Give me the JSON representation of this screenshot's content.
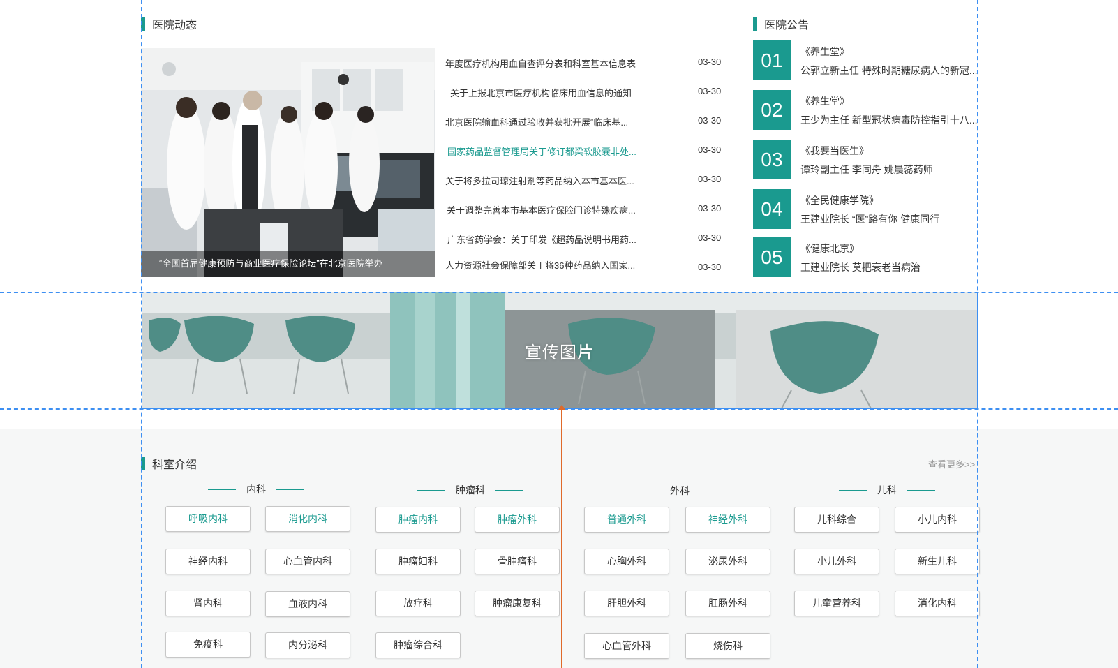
{
  "news": {
    "title": "医院动态",
    "photo_caption": "“全国首届健康预防与商业医疗保险论坛”在北京医院举办",
    "items": [
      {
        "title": "年度医疗机构用血自查评分表和科室基本信息表",
        "date": "03-30"
      },
      {
        "title": "关于上报北京市医疗机构临床用血信息的通知",
        "date": "03-30"
      },
      {
        "title": "北京医院输血科通过验收并获批开展“临床基...",
        "date": "03-30"
      },
      {
        "title": "国家药品监督管理局关于修订都梁软胶囊非处...",
        "date": "03-30"
      },
      {
        "title": "关于将多拉司琼注射剂等药品纳入本市基本医...",
        "date": "03-30"
      },
      {
        "title": "关于调整完善本市基本医疗保险门诊特殊疾病...",
        "date": "03-30"
      },
      {
        "title": "广东省药学会：关于印发《超药品说明书用药...",
        "date": "03-30"
      },
      {
        "title": "人力资源社会保障部关于将36种药品纳入国家...",
        "date": "03-30"
      }
    ]
  },
  "notices": {
    "title": "医院公告",
    "items": [
      {
        "num": "01",
        "source": "《养生堂》",
        "text": "公郭立新主任 特殊时期糖尿病人的新冠..."
      },
      {
        "num": "02",
        "source": "《养生堂》",
        "text": "王少为主任 新型冠状病毒防控指引十八..."
      },
      {
        "num": "03",
        "source": "《我要当医生》",
        "text": "谭玲副主任 李同舟 姚晨蕊药师"
      },
      {
        "num": "04",
        "source": "《全民健康学院》",
        "text": "王建业院长 “医”路有你 健康同行"
      },
      {
        "num": "05",
        "source": "《健康北京》",
        "text": "王建业院长 莫把衰老当病治"
      }
    ]
  },
  "banner": {
    "label": "宣传图片"
  },
  "departments": {
    "title": "科室介绍",
    "more": "查看更多>>",
    "categories": [
      {
        "name": "内科",
        "items": [
          "呼吸内科",
          "消化内科",
          "神经内科",
          "心血管内科",
          "肾内科",
          "血液内科",
          "免疫科",
          "内分泌科"
        ]
      },
      {
        "name": "肿瘤科",
        "items": [
          "肿瘤内科",
          "肿瘤外科",
          "肿瘤妇科",
          "骨肿瘤科",
          "放疗科",
          "肿瘤康复科",
          "肿瘤综合科"
        ]
      },
      {
        "name": "外科",
        "items": [
          "普通外科",
          "神经外科",
          "心胸外科",
          "泌尿外科",
          "肝胆外科",
          "肛肠外科",
          "心血管外科",
          "烧伤科"
        ]
      },
      {
        "name": "儿科",
        "items": [
          "儿科综合",
          "小儿内科",
          "小儿外科",
          "新生儿科",
          "儿童营养科",
          "消化内科"
        ]
      }
    ]
  },
  "theme": {
    "accent": "#1a9a8f",
    "guide": "#3d8ff2",
    "measure": "#e06a2a"
  }
}
